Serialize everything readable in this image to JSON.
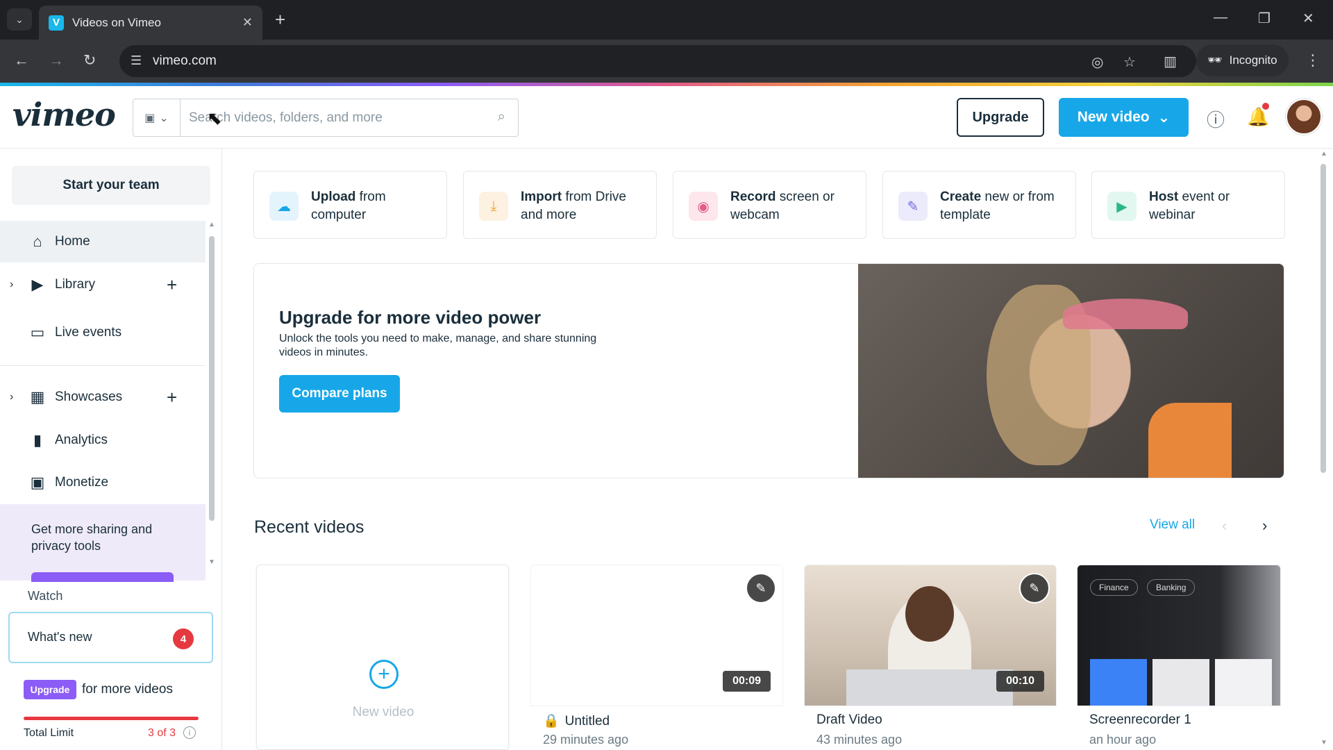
{
  "browser": {
    "tab_title": "Videos on Vimeo",
    "tab_favicon": "V",
    "url": "vimeo.com",
    "incognito_label": "Incognito"
  },
  "header": {
    "logo": "vimeo",
    "search_placeholder": "Search videos, folders, and more",
    "upgrade_label": "Upgrade",
    "new_video_label": "New video"
  },
  "sidebar": {
    "start_team": "Start your team",
    "items": [
      {
        "label": "Home"
      },
      {
        "label": "Library"
      },
      {
        "label": "Live events"
      },
      {
        "label": "Showcases"
      },
      {
        "label": "Analytics"
      },
      {
        "label": "Monetize"
      }
    ],
    "promo_text": "Get more sharing and privacy tools",
    "watch_label": "Watch",
    "whats_new_label": "What's new",
    "whats_new_count": "4",
    "upgrade_badge": "Upgrade",
    "upgrade_text": "for more videos",
    "limit_label": "Total Limit",
    "limit_value": "3 of 3",
    "limit_info": "i"
  },
  "actions": [
    {
      "bold": "Upload",
      "rest": " from computer",
      "icon": "cloud-upload-icon",
      "bg": "#e4f4fc",
      "color": "#17a7e8"
    },
    {
      "bold": "Import",
      "rest": " from Drive and more",
      "icon": "download-icon",
      "bg": "#fdf1e1",
      "color": "#f3a431"
    },
    {
      "bold": "Record",
      "rest": " screen or webcam",
      "icon": "record-icon",
      "bg": "#fde6ec",
      "color": "#e25b8a"
    },
    {
      "bold": "Create",
      "rest": " new or from template",
      "icon": "create-icon",
      "bg": "#ecebfb",
      "color": "#6f68e0"
    },
    {
      "bold": "Host",
      "rest": " event or webinar",
      "icon": "camera-icon",
      "bg": "#e2f7f0",
      "color": "#2bb68a"
    }
  ],
  "promo": {
    "title": "Upgrade for more video power",
    "description": "Unlock the tools you need to make, manage, and share stunning videos in minutes.",
    "cta": "Compare plans"
  },
  "recent": {
    "title": "Recent videos",
    "view_all": "View all",
    "new_video_label": "New video",
    "videos": [
      {
        "name": "Untitled",
        "time": "29 minutes ago",
        "duration": "00:09",
        "private": true
      },
      {
        "name": "Draft Video",
        "time": "43 minutes ago",
        "duration": "00:10",
        "private": false
      },
      {
        "name": "Screenrecorder 1",
        "time": "an hour ago",
        "private": false
      }
    ],
    "screenrecorder_chips": [
      "Finance",
      "Banking"
    ]
  }
}
